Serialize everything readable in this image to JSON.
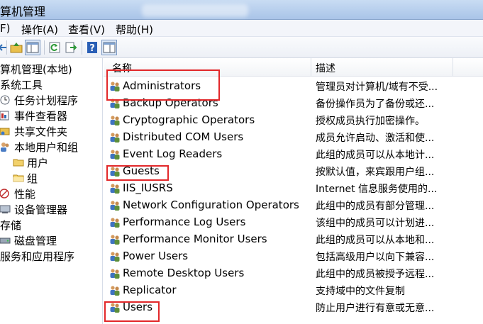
{
  "window": {
    "title": "算机管理"
  },
  "menu": {
    "file": "F)",
    "action": "操作(A)",
    "view": "查看(V)",
    "help": "帮助(H)"
  },
  "toolbar": {
    "buttons": [
      "back-arrow-icon",
      "up-folder-icon",
      "show-tree-icon",
      "refresh-icon",
      "export-icon",
      "help-icon",
      "properties-icon"
    ]
  },
  "tree": {
    "items": [
      {
        "label": "算机管理(本地)",
        "icon": ""
      },
      {
        "label": "系统工具",
        "icon": ""
      },
      {
        "label": "任务计划程序",
        "icon": "clock-icon"
      },
      {
        "label": "事件查看器",
        "icon": "event-viewer-icon"
      },
      {
        "label": "共享文件夹",
        "icon": "shared-folder-icon"
      },
      {
        "label": "本地用户和组",
        "icon": "users-icon"
      },
      {
        "label": "用户",
        "icon": "folder-icon"
      },
      {
        "label": "组",
        "icon": "folder-icon"
      },
      {
        "label": "性能",
        "icon": "performance-icon"
      },
      {
        "label": "设备管理器",
        "icon": "device-manager-icon"
      },
      {
        "label": "存储",
        "icon": ""
      },
      {
        "label": "磁盘管理",
        "icon": "disk-icon"
      },
      {
        "label": "服务和应用程序",
        "icon": ""
      }
    ]
  },
  "list": {
    "columns": {
      "name": "名称",
      "description": "描述"
    },
    "rows": [
      {
        "name": "Administrators",
        "description": "管理员对计算机/域有不受..."
      },
      {
        "name": "Backup Operators",
        "description": "备份操作员为了备份或还..."
      },
      {
        "name": "Cryptographic Operators",
        "description": "授权成员执行加密操作。"
      },
      {
        "name": "Distributed COM Users",
        "description": "成员允许启动、激活和使..."
      },
      {
        "name": "Event Log Readers",
        "description": "此组的成员可以从本地计..."
      },
      {
        "name": "Guests",
        "description": "按默认值，来宾跟用户组..."
      },
      {
        "name": "IIS_IUSRS",
        "description": "Internet 信息服务使用的..."
      },
      {
        "name": "Network Configuration Operators",
        "description": "此组中的成员有部分管理..."
      },
      {
        "name": "Performance Log Users",
        "description": "该组中的成员可以计划进..."
      },
      {
        "name": "Performance Monitor Users",
        "description": "此组的成员可以从本地和..."
      },
      {
        "name": "Power Users",
        "description": "包括高级用户以向下兼容..."
      },
      {
        "name": "Remote Desktop Users",
        "description": "此组中的成员被授予远程..."
      },
      {
        "name": "Replicator",
        "description": "支持域中的文件复制"
      },
      {
        "name": "Users",
        "description": "防止用户进行有意或无意..."
      }
    ]
  },
  "colors": {
    "highlight": "#e2282a",
    "selected_folder": "#f6d874"
  }
}
